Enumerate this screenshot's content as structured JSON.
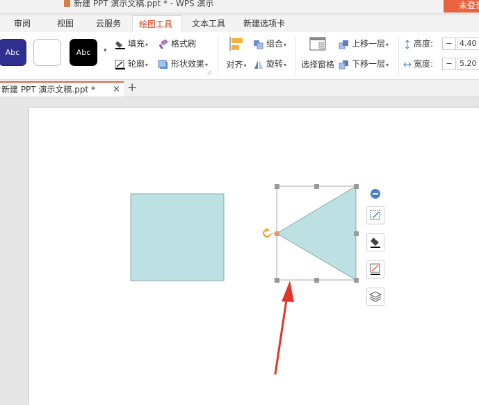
{
  "window": {
    "title": "新建 PPT 演示文稿.ppt * - WPS 演示",
    "login_label": "未登录"
  },
  "ribbon_tabs": [
    {
      "label": "审阅"
    },
    {
      "label": "视图"
    },
    {
      "label": "云服务"
    },
    {
      "label": "绘图工具"
    },
    {
      "label": "文本工具"
    },
    {
      "label": "新建选项卡"
    }
  ],
  "ribbon": {
    "style_swatches": [
      {
        "label": "Abc",
        "fill": "#2f2f8f"
      },
      {
        "label": "",
        "fill": "#ffffff"
      },
      {
        "label": "Abc",
        "fill": "#000000"
      }
    ],
    "fill_label": "填充",
    "format_painter_label": "格式刷",
    "outline_label": "轮廓",
    "shape_effects_label": "形状效果",
    "align_label": "对齐",
    "group_label": "组合",
    "rotate_label": "旋转",
    "selection_pane_label": "选择窗格",
    "bring_forward_label": "上移一层",
    "send_backward_label": "下移一层",
    "height_label": "高度:",
    "height_value": "4.40",
    "width_label": "宽度:",
    "width_value": "5.20",
    "minus_label": "−"
  },
  "document_tab": {
    "label": "新建 PPT 演示文稿.ppt *",
    "close": "×",
    "add": "+"
  },
  "colors": {
    "accent": "#c8451f",
    "login": "#e9633f",
    "shape_fill": "#bde0e3",
    "arrow": "#e0352b"
  }
}
